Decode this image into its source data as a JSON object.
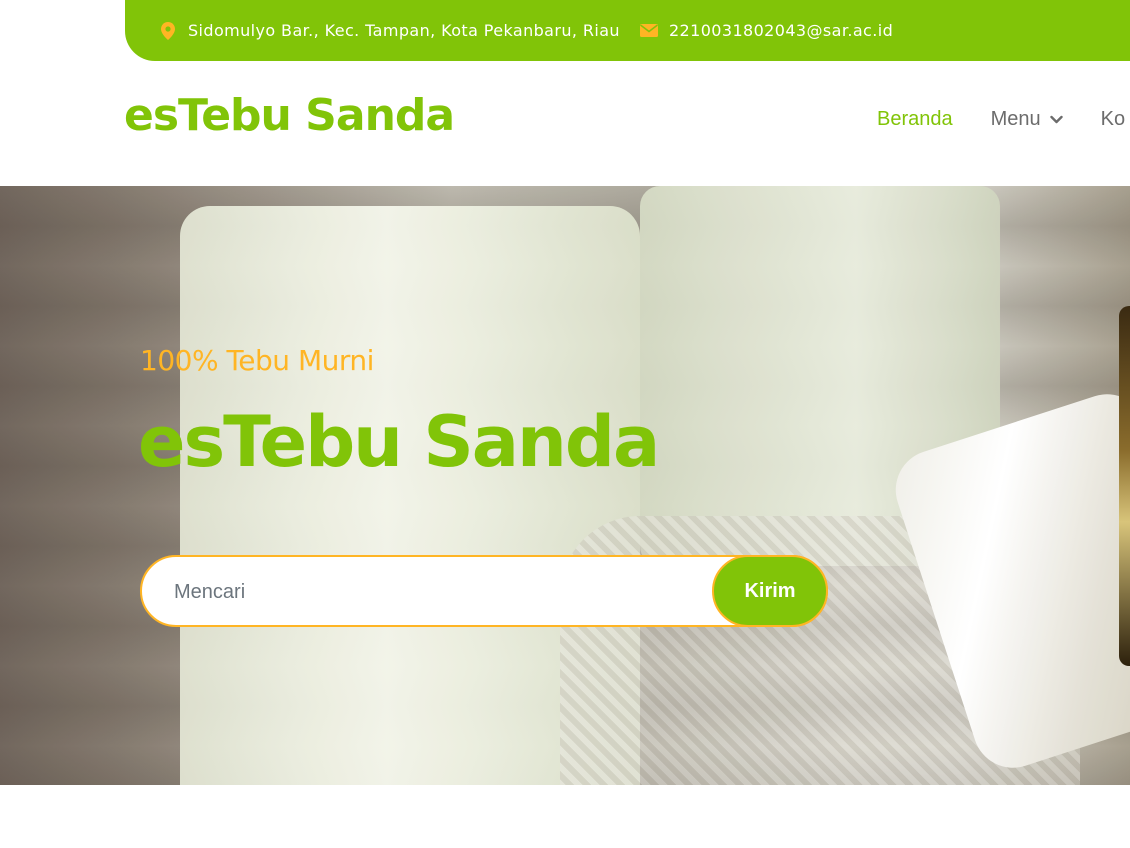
{
  "topbar": {
    "address": "Sidomulyo Bar., Kec. Tampan, Kota Pekanbaru, Riau",
    "email": "2210031802043@sar.ac.id",
    "address_icon": "map-marker-icon",
    "email_icon": "envelope-icon"
  },
  "navbar": {
    "brand": "esTebu Sanda",
    "links": [
      {
        "label": "Beranda",
        "active": true
      },
      {
        "label": "Menu",
        "dropdown": true
      },
      {
        "label": "Ko"
      }
    ]
  },
  "hero": {
    "subtitle": "100% Tebu Murni",
    "title": "esTebu Sanda",
    "search": {
      "placeholder": "Mencari",
      "value": "",
      "button_label": "Kirim"
    }
  },
  "colors": {
    "primary": "#81c408",
    "secondary": "#ffb524",
    "nav_text": "#6c6c6c"
  }
}
